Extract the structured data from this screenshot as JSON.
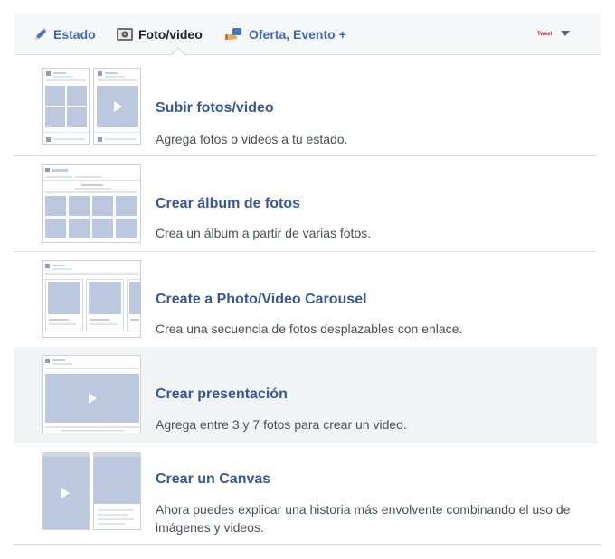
{
  "tabs": [
    {
      "label": "Estado",
      "icon": "pencil-icon"
    },
    {
      "label": "Foto/video",
      "icon": "camera-icon"
    },
    {
      "label": "Oferta, Evento +",
      "icon": "offer-hand-icon"
    }
  ],
  "audience": {
    "flag_text": "Tweet",
    "icon": "flag-icon"
  },
  "items": [
    {
      "title": "Subir fotos/video",
      "desc": "Agrega fotos o videos a tu estado."
    },
    {
      "title": "Crear álbum de fotos",
      "desc": "Crea un álbum a partir de varias fotos."
    },
    {
      "title": "Create a Photo/Video Carousel",
      "desc": "Crea una secuencia de fotos desplazables con enlace."
    },
    {
      "title": "Crear presentación",
      "desc": "Agrega entre 3 y 7 fotos para crear un video."
    },
    {
      "title": "Crear un Canvas",
      "desc": "Ahora puedes explicar una historia más envolvente combinando el uso de imágenes y videos."
    }
  ],
  "colors": {
    "link": "#4267b2",
    "title": "#365899",
    "thumb_fill": "#bcc8e0",
    "highlight": "#f2f3f5"
  }
}
